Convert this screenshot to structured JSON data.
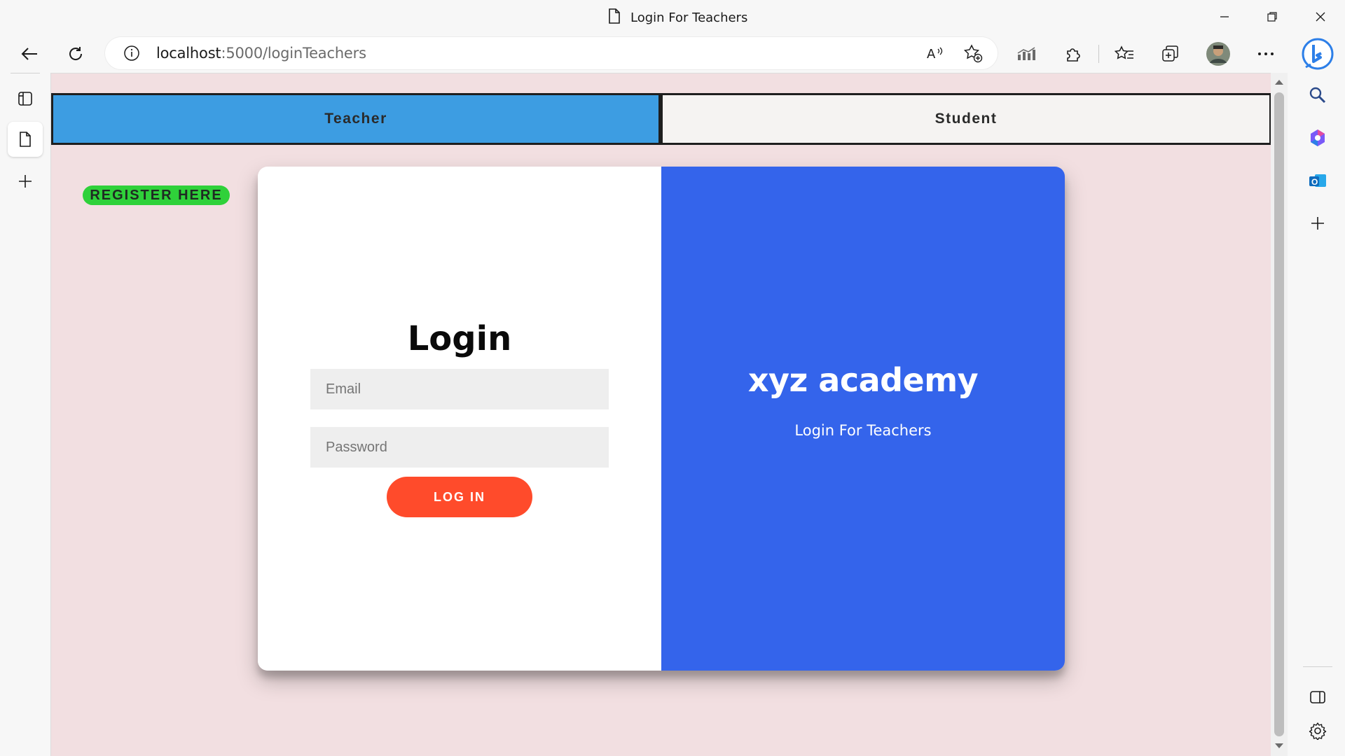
{
  "browser": {
    "tab_title": "Login For Teachers",
    "url_host": "localhost",
    "url_rest": ":5000/loginTeachers",
    "icons": [
      "back-icon",
      "refresh-icon",
      "info-icon",
      "read-aloud-icon",
      "add-favorite-icon",
      "performance-icon",
      "extensions-icon",
      "favorites-icon",
      "collections-icon",
      "profile-avatar",
      "more-icon",
      "bing-copilot-icon",
      "search-icon",
      "office-icon",
      "outlook-icon",
      "add-icon",
      "split-screen-icon",
      "settings-icon",
      "tab-actions-icon",
      "page-tab-icon",
      "new-tab-icon",
      "minimize-icon",
      "restore-icon",
      "close-icon"
    ],
    "colors": {
      "chrome": "#f7f7f7",
      "page_bg": "#f2dfe1"
    }
  },
  "page": {
    "tabs": {
      "teacher": "Teacher",
      "student": "Student"
    },
    "register_label": "REGISTER HERE",
    "login": {
      "title": "Login",
      "email_placeholder": "Email",
      "password_placeholder": "Password",
      "button_label": "LOG IN"
    },
    "brand": {
      "name": "xyz academy",
      "subtitle": "Login For Teachers"
    },
    "colors": {
      "teacher_tab": "#3d9de2",
      "student_tab": "#f5f3f2",
      "register": "#2fd13a",
      "panel_right": "#3464eb",
      "login_button": "#ff4b2b"
    }
  }
}
